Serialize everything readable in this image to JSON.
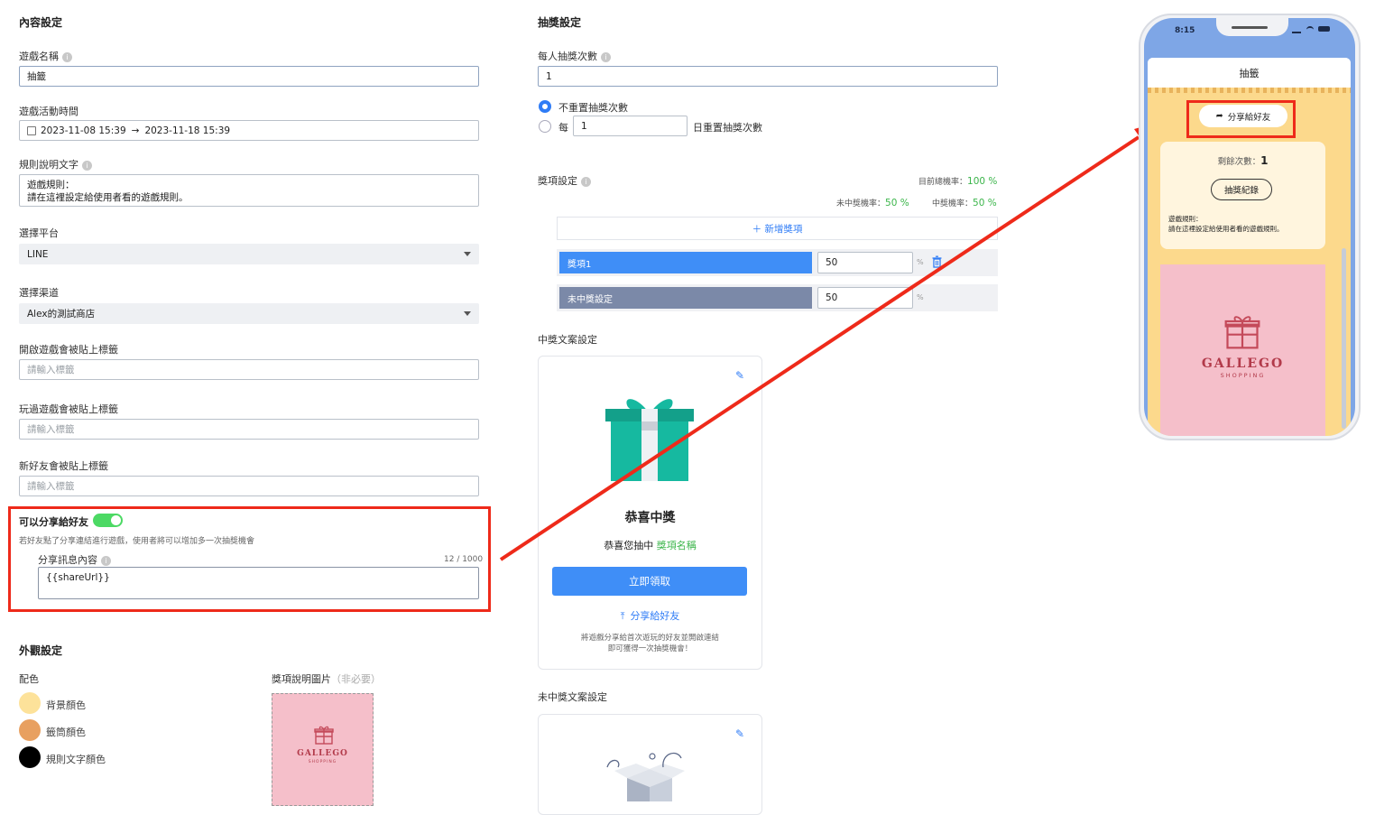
{
  "content": {
    "section_title": "內容設定",
    "game_name_label": "遊戲名稱",
    "game_name_value": "抽籤",
    "period_label": "遊戲活動時間",
    "period_start": "2023-11-08 15:39",
    "period_arrow": "→",
    "period_end": "2023-11-18 15:39",
    "rules_label": "規則說明文字",
    "rules_line1": "遊戲規則：",
    "rules_line2": "請在這裡設定給使用者看的遊戲規則。",
    "platform_label": "選擇平台",
    "platform_value": "LINE",
    "channel_label": "選擇渠道",
    "channel_value": "Alex的測試商店",
    "tag_open_label": "開啟遊戲會被貼上標籤",
    "tag_played_label": "玩過遊戲會被貼上標籤",
    "tag_newfriend_label": "新好友會被貼上標籤",
    "tag_placeholder": "請輸入標籤",
    "share_label": "可以分享給好友",
    "share_desc": "若好友點了分享連結進行遊戲，使用者將可以增加多一次抽獎機會",
    "share_msg_label": "分享訊息內容",
    "share_msg_count": "12 / 1000",
    "share_msg_value": "{{shareUrl}}"
  },
  "appearance": {
    "section_title": "外觀設定",
    "color_label": "配色",
    "colors": [
      {
        "name": "背景顏色",
        "hex": "#fde29a"
      },
      {
        "name": "籤筒顏色",
        "hex": "#e8a060"
      },
      {
        "name": "規則文字顏色",
        "hex": "#000000"
      }
    ],
    "prize_img_label": "獎項說明圖片",
    "prize_img_optional": "（非必要）"
  },
  "lottery": {
    "section_title": "抽獎設定",
    "per_person_label": "每人抽獎次數",
    "per_person_value": "1",
    "no_reset_label": "不重置抽獎次數",
    "every_label": "每",
    "every_value": "1",
    "reset_suffix": "日重置抽獎次數",
    "prize_settings_label": "獎項設定",
    "total_rate_label": "目前總機率：",
    "total_rate_value": "100 %",
    "no_win_rate_label": "未中獎機率：",
    "no_win_rate_value": "50 %",
    "win_rate_label": "中獎機率：",
    "win_rate_value": "50 %",
    "add_prize": "＋ 新增獎項",
    "prizes": [
      {
        "name": "獎項1",
        "value": "50",
        "unit": "%"
      },
      {
        "name": "未中獎設定",
        "value": "50",
        "unit": "%"
      }
    ]
  },
  "win_copy": {
    "section_title": "中獎文案設定",
    "title": "恭喜中獎",
    "subtitle_prefix": "恭喜您抽中 ",
    "subtitle_highlight": "獎項名稱",
    "claim_button": "立即領取",
    "share_link": "分享給好友",
    "note_line1": "將遊戲分享給首次遊玩的好友並開啟連結",
    "note_line2": "即可獲得一次抽獎機會！"
  },
  "lose_copy": {
    "section_title": "未中獎文案設定"
  },
  "brand": {
    "name": "GALLEGO",
    "sub": "SHOPPING"
  },
  "phone": {
    "time": "8:15",
    "title": "抽籤",
    "share_button": "分享給好友",
    "remaining_label": "剩餘次數：",
    "remaining_value": "1",
    "record_button": "抽獎紀錄",
    "rules_line1": "遊戲規則：",
    "rules_line2": "請在這裡設定給使用者看的遊戲規則。"
  },
  "colors": {
    "accent": "#2f7cf6",
    "toggle_on": "#4cd964",
    "highlight_red": "#ee2a1a",
    "prize_bar": "#3f8ef7",
    "no_win_bar": "#7b89a8",
    "rate_green": "#3bb54a",
    "gift_teal": "#16b9a0"
  }
}
